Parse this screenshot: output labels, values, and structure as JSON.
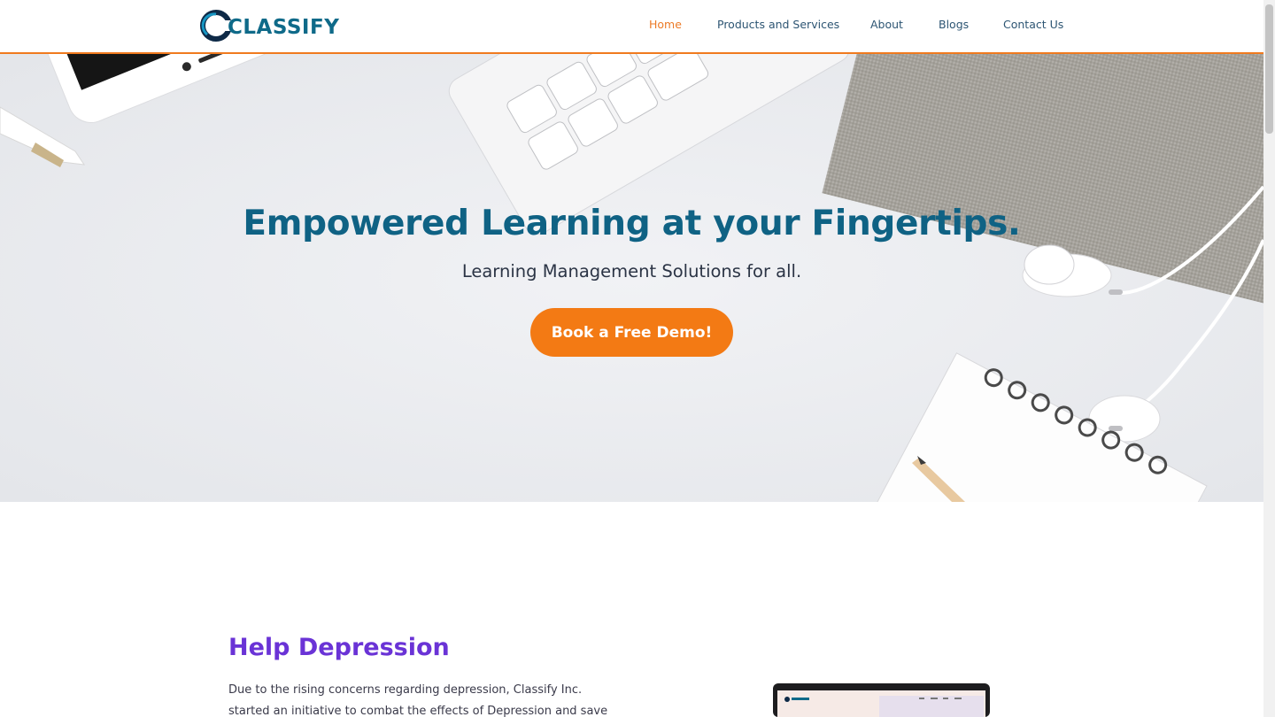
{
  "brand": {
    "name": "CLASSIFY"
  },
  "nav": {
    "items": [
      {
        "label": "Home",
        "active": true
      },
      {
        "label": "Products and Services",
        "active": false
      },
      {
        "label": "About",
        "active": false
      },
      {
        "label": "Blogs",
        "active": false
      },
      {
        "label": "Contact Us",
        "active": false
      }
    ]
  },
  "hero": {
    "title": "Empowered Learning at your Fingertips.",
    "subtitle": "Learning Management Solutions for all.",
    "cta_label": "Book a Free Demo!"
  },
  "section": {
    "title": "Help Depression",
    "body_line1": "Due to the rising concerns regarding depression, Classify Inc.",
    "body_line2": "started an initiative to combat the effects of Depression and save"
  },
  "colors": {
    "accent": "#f37a14",
    "nav_active": "#ec7a26",
    "brand_blue": "#0f6284",
    "section_title": "#6a33d6"
  },
  "icons": {
    "logo": "classify-logo-icon"
  }
}
